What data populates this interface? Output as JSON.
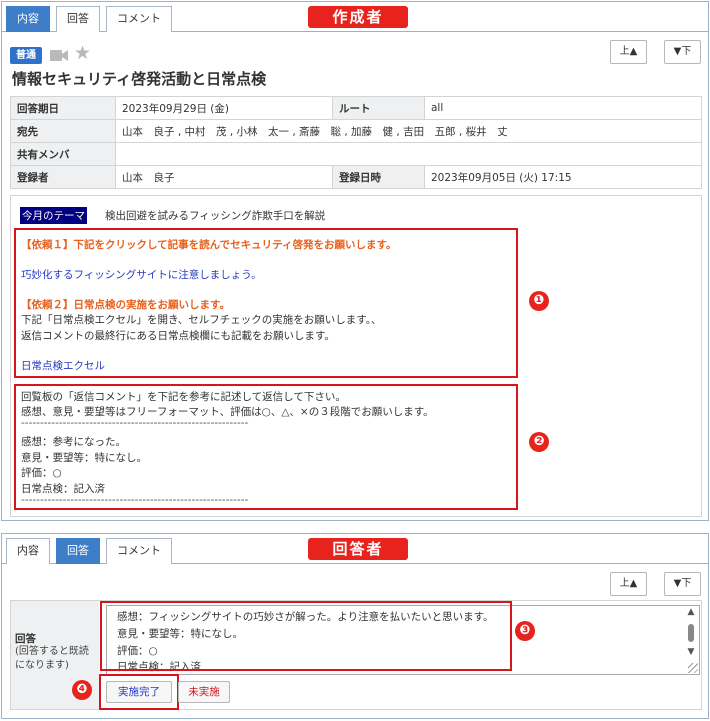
{
  "top_panel": {
    "tabs": [
      "内容",
      "回答",
      "コメント"
    ],
    "active_tab": 0,
    "role_banner": "作成者",
    "nav": {
      "up": "上▲",
      "down": "▼下"
    },
    "badge": "普通",
    "icons": {
      "video": "video-camera-icon",
      "star": "star-icon"
    },
    "title": "情報セキュリティ啓発活動と日常点検",
    "info": {
      "due_label": "回答期日",
      "due_value": "2023年09月29日 (金)",
      "route_label": "ルート",
      "route_value": "all",
      "to_label": "宛先",
      "to_value": "山本　良子 , 中村　茂 , 小林　太一 , 斎藤　聡 , 加藤　健 , 吉田　五郎 , 桜井　丈",
      "shared_label": "共有メンバ",
      "shared_value": "",
      "registrant_label": "登録者",
      "registrant_value": "山本　良子",
      "reg_date_label": "登録日時",
      "reg_date_value": "2023年09月05日 (火) 17:15"
    },
    "theme_label": "今月のテーマ",
    "theme_text": "検出回避を試みるフィッシング詐欺手口を解説",
    "request_lines": [
      "【依頼１】下記をクリックして記事を読んでセキュリティ啓発をお願いします。",
      "巧妙化するフィッシングサイトに注意しましょう。",
      "【依頼２】日常点検の実施をお願いします。",
      "下記「日常点検エクセル」を開き、セルフチェックの実施をお願いします。、",
      "返信コメントの最終行にある日常点検欄にも記載をお願いします。",
      "日常点検エクセル"
    ],
    "template_lines": [
      "回覧板の「返信コメント」を下記を参考に記述して返信して下さい。",
      "感想、意見・要望等はフリーフォーマット、評価は○、△、×の３段階でお願いします。",
      "------------------------------------------------------------",
      "感想：参考になった。",
      "意見・要望等：特になし。",
      "評価：○",
      "日常点検：記入済",
      "------------------------------------------------------------"
    ],
    "markers": [
      "❶",
      "❷"
    ]
  },
  "bottom_panel": {
    "tabs": [
      "内容",
      "回答",
      "コメント"
    ],
    "active_tab": 1,
    "role_banner": "回答者",
    "nav": {
      "up": "上▲",
      "down": "▼下"
    },
    "answer_label": "回答",
    "answer_note": "(回答すると既読になります)",
    "answer_lines": [
      "感想：フィッシングサイトの巧妙さが解った。より注意を払いたいと思います。",
      "意見・要望等：特になし。",
      "評価：○",
      "日常点検：記入済"
    ],
    "done_button": "実施完了",
    "not_done_button": "未実施",
    "markers": [
      "❸",
      "❹"
    ]
  },
  "colors": {
    "tab_active": "#3e7ec9",
    "banner_red": "#e8231d",
    "highlight_orange": "#e8611d",
    "link_blue": "#2439c6",
    "badge_blue": "#2e73c9",
    "theme_navy": "#000080"
  }
}
